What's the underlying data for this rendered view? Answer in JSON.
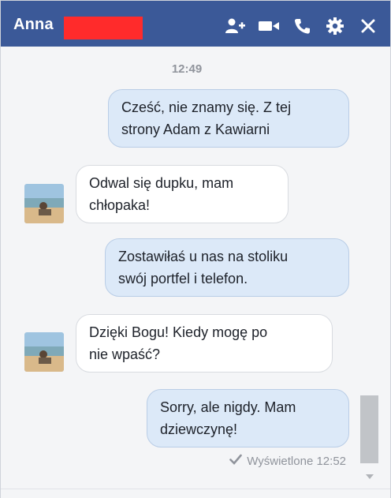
{
  "titlebar": {
    "contact_name": "Anna",
    "redaction_color": "#ff2b2b",
    "actions": [
      {
        "name": "add-people-icon"
      },
      {
        "name": "video-call-icon"
      },
      {
        "name": "voice-call-icon"
      },
      {
        "name": "settings-gear-icon"
      },
      {
        "name": "close-icon"
      }
    ]
  },
  "conversation": {
    "timestamp": "12:49",
    "messages": [
      {
        "direction": "outgoing",
        "text": "Cześć, nie znamy się. Z tej\nstrony Adam z Kawiarni"
      },
      {
        "direction": "incoming",
        "text": "Odwal się dupku, mam\nchłopaka!"
      },
      {
        "direction": "outgoing",
        "text": "Zostawiłaś u nas na stoliku\nswój portfel i telefon."
      },
      {
        "direction": "incoming",
        "text": "Dzięki Bogu! Kiedy mogę po\nnie wpaść?"
      },
      {
        "direction": "outgoing",
        "text": "Sorry, ale nigdy. Mam\ndziewczynę!"
      }
    ],
    "seen_label": "Wyświetlone 12:52"
  },
  "colors": {
    "header_blue": "#3b5998",
    "outgoing_bubble": "#dce9f8",
    "incoming_bubble": "#ffffff",
    "meta_gray": "#90949c"
  }
}
